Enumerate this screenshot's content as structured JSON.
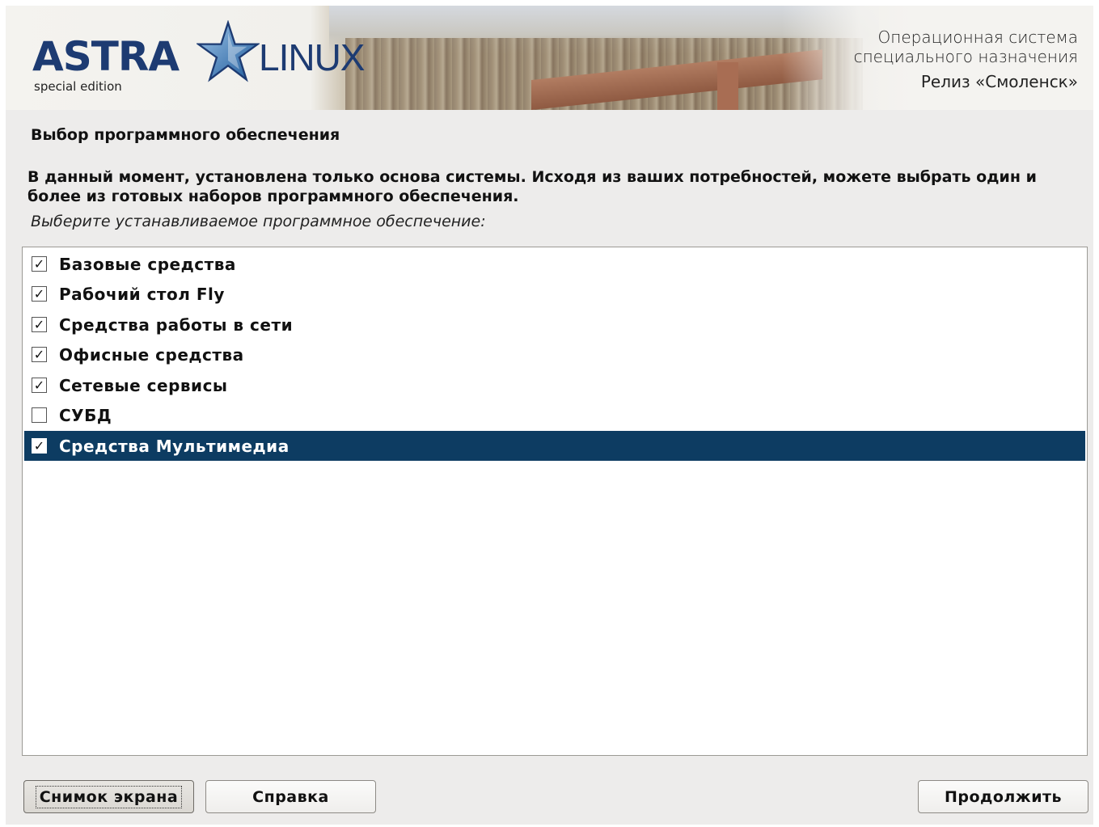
{
  "banner": {
    "logo_main": "ASTRA",
    "logo_secondary": "LINUX",
    "logo_edition": "special edition",
    "subtitle_line1": "Операционная система",
    "subtitle_line2": "специального назначения",
    "release": "Релиз «Смоленск»"
  },
  "page": {
    "title": "Выбор программного обеспечения",
    "description": "В данный момент, установлена только основа системы. Исходя из ваших потребностей, можете выбрать один и более из готовых наборов программного обеспечения.",
    "prompt": "Выберите устанавливаемое программное обеспечение:"
  },
  "software_list": [
    {
      "label": "Базовые средства",
      "checked": true,
      "selected": false
    },
    {
      "label": "Рабочий стол Fly",
      "checked": true,
      "selected": false
    },
    {
      "label": "Средства работы в сети",
      "checked": true,
      "selected": false
    },
    {
      "label": "Офисные средства",
      "checked": true,
      "selected": false
    },
    {
      "label": "Сетевые сервисы",
      "checked": true,
      "selected": false
    },
    {
      "label": "СУБД",
      "checked": false,
      "selected": false
    },
    {
      "label": "Средства Мультимедиа",
      "checked": true,
      "selected": true
    }
  ],
  "buttons": {
    "screenshot": "Снимок экрана",
    "help": "Справка",
    "continue": "Продолжить"
  },
  "colors": {
    "selection": "#0d3c62",
    "logo": "#1d3b72",
    "background": "#edeceb"
  }
}
